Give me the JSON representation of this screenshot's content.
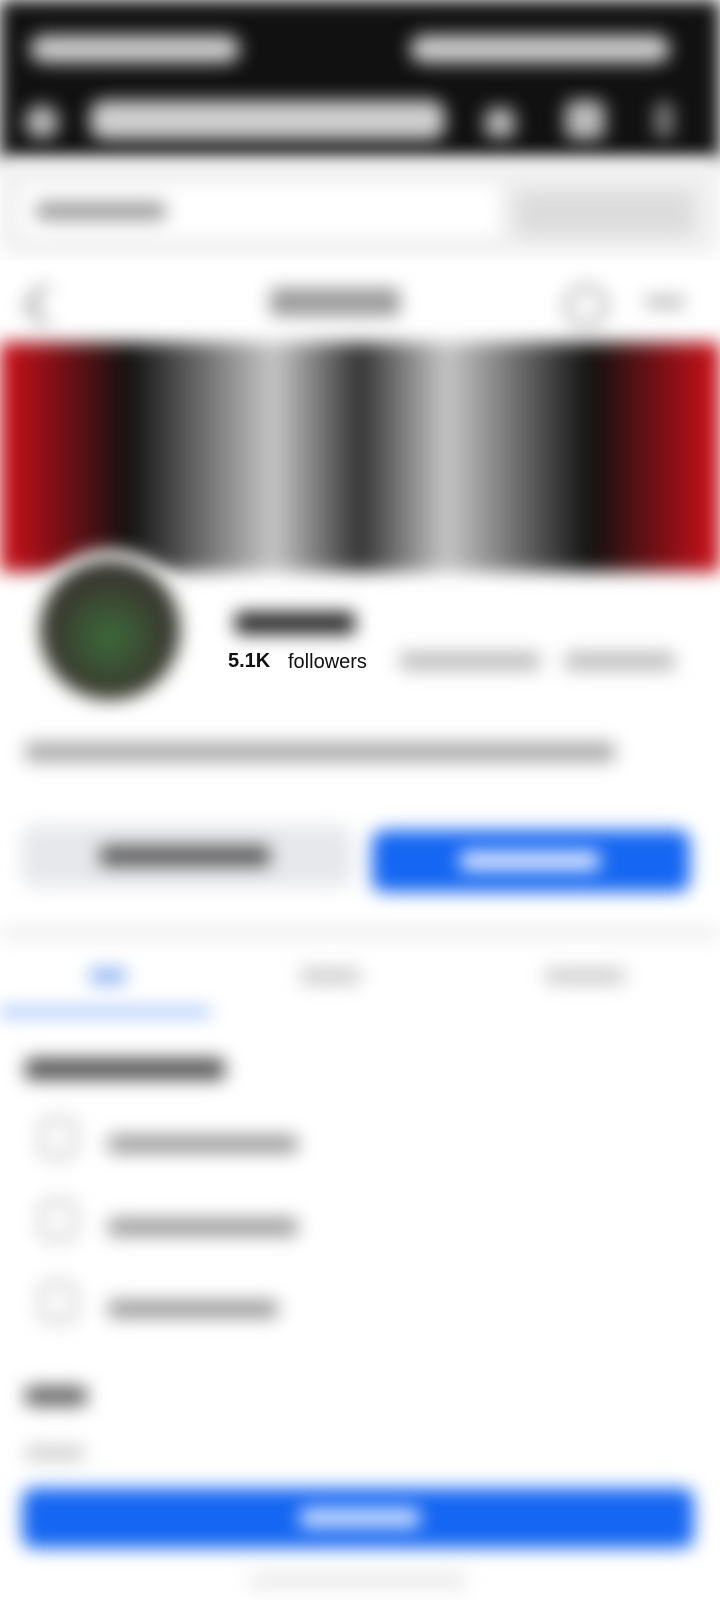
{
  "profile": {
    "followers_count": "5.1K",
    "followers_label": "followers"
  },
  "colors": {
    "primary_blue": "#1566f2",
    "cover_red": "#d0101a",
    "chrome_black": "#111111"
  },
  "icons": [
    "back-icon",
    "search-icon",
    "more-icon",
    "message-icon",
    "follow-icon",
    "info-icon"
  ]
}
